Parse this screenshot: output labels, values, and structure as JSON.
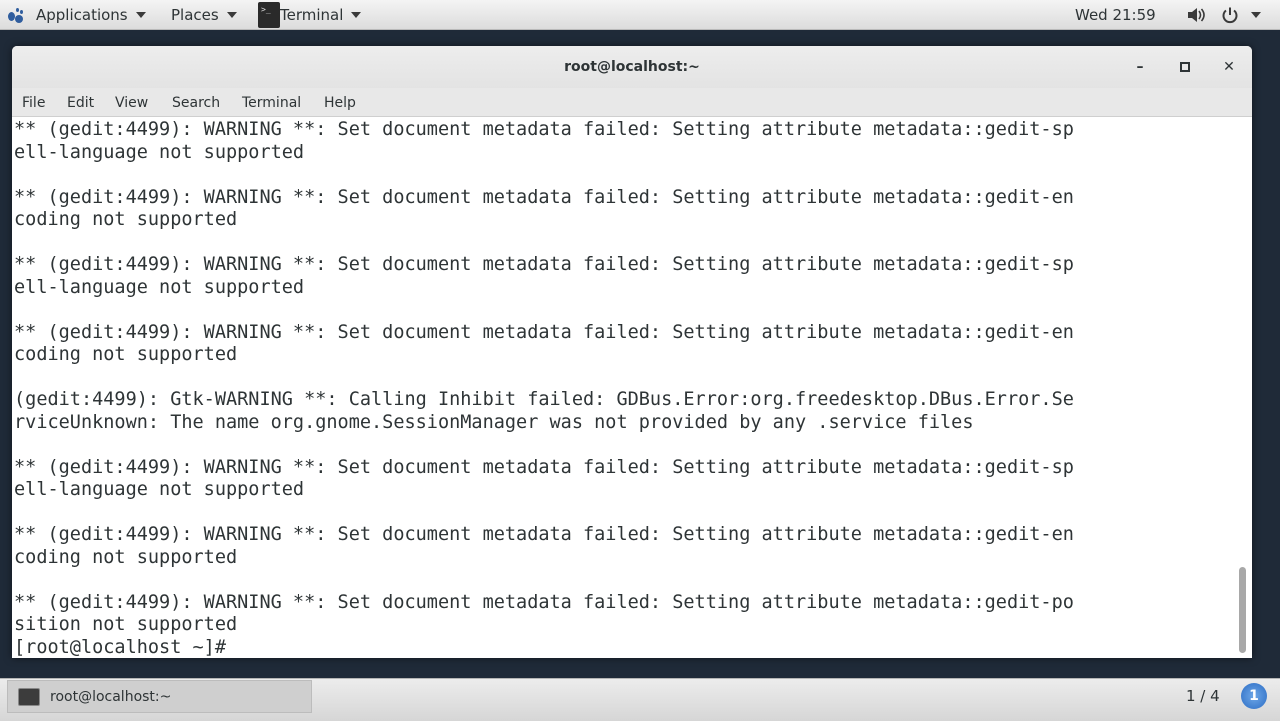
{
  "top_bar": {
    "applications_label": "Applications",
    "places_label": "Places",
    "terminal_label": "Terminal",
    "clock": "Wed 21:59"
  },
  "window": {
    "title": "root@localhost:~",
    "menu": [
      "File",
      "Edit",
      "View",
      "Search",
      "Terminal",
      "Help"
    ]
  },
  "terminal": {
    "lines": [
      "** (gedit:4499): WARNING **: Set document metadata failed: Setting attribute metadata::gedit-sp",
      "ell-language not supported",
      "",
      "** (gedit:4499): WARNING **: Set document metadata failed: Setting attribute metadata::gedit-en",
      "coding not supported",
      "",
      "** (gedit:4499): WARNING **: Set document metadata failed: Setting attribute metadata::gedit-sp",
      "ell-language not supported",
      "",
      "** (gedit:4499): WARNING **: Set document metadata failed: Setting attribute metadata::gedit-en",
      "coding not supported",
      "",
      "(gedit:4499): Gtk-WARNING **: Calling Inhibit failed: GDBus.Error:org.freedesktop.DBus.Error.Se",
      "rviceUnknown: The name org.gnome.SessionManager was not provided by any .service files",
      "",
      "** (gedit:4499): WARNING **: Set document metadata failed: Setting attribute metadata::gedit-sp",
      "ell-language not supported",
      "",
      "** (gedit:4499): WARNING **: Set document metadata failed: Setting attribute metadata::gedit-en",
      "coding not supported",
      "",
      "** (gedit:4499): WARNING **: Set document metadata failed: Setting attribute metadata::gedit-po",
      "sition not supported",
      "[root@localhost ~]#"
    ]
  },
  "bottom_bar": {
    "task_label": "root@localhost:~",
    "workspace": "1 / 4",
    "notification_count": "1"
  },
  "colors": {
    "desktop_bg": "#1f2a38",
    "terminal_bg": "#ffffff",
    "terminal_fg": "#2e3436"
  },
  "icons": [
    "gnome-foot-icon",
    "terminal-icon",
    "volume-icon",
    "power-icon",
    "minimize-icon",
    "maximize-icon",
    "close-icon"
  ]
}
